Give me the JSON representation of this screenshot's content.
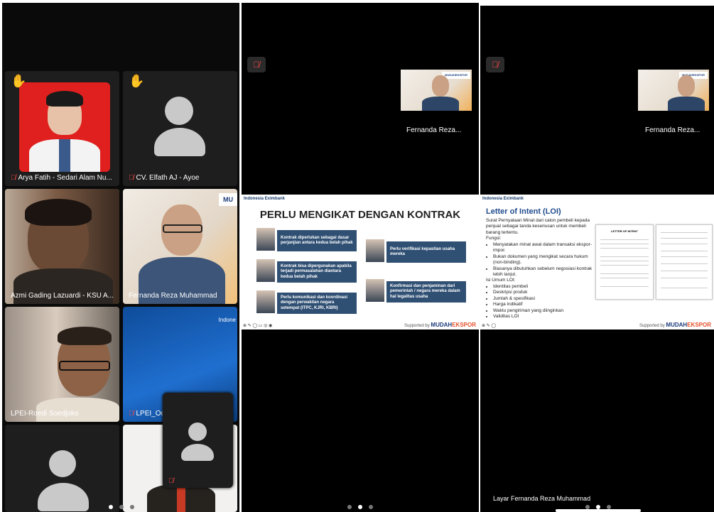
{
  "gallery": {
    "tiles": [
      {
        "name": "Arya Fatih - Sedari Alam Nu...",
        "hand": "✋"
      },
      {
        "name": "CV. Elfath AJ - Ayoe",
        "hand": "✋"
      },
      {
        "name": "Azmi Gading Lazuardi - KSU A..."
      },
      {
        "name": "Fernanda Reza Muhammad",
        "badge": "MU"
      },
      {
        "name": "LPEI-Roedi Soedjoko"
      },
      {
        "name": "LPEI_Od",
        "bg_text": "Indone"
      }
    ]
  },
  "presenter": {
    "name_1": "Fernanda Reza...",
    "name_2": "Fernanda Reza...",
    "badge_1": "MUDAHEKSPOR",
    "badge_2": "MUDAHEKSPOR"
  },
  "slide1": {
    "logo": "Indonesia Eximbank",
    "title": "PERLU MENGIKAT DENGAN KONTRAK",
    "boxes": [
      "Kontrak diperlukan sebagai dasar perjanjian antara kedua belah pihak",
      "Kontrak bisa dipergunakan apabila terjadi permasalahan diantara kedua belah pihak",
      "Perlu komunikasi dan koordinasi dengan perwakilan negara setempat (ITPC, KJRI, KBRI)",
      "Perlu verifikasi kepastian usaha mereka",
      "Konfirmasi dan penjaminan dari pemerintah / negara mereka dalam hal legalitas usaha"
    ],
    "supported": "Supported by",
    "brand_a": "MUDAH",
    "brand_b": "EKSPOR"
  },
  "slide2": {
    "logo": "Indonesia Eximbank",
    "title": "Letter of Intent (LOI)",
    "intro": "Surat Pernyataan Minat dari calon pembeli kepada penjual sebagai tanda keseriusan untuk membeli barang tertentu.",
    "fungsi_label": "Fungsi:",
    "fungsi": [
      "Menyatakan minat awal dalam transaksi ekspor-impor.",
      "Bukan dokumen yang mengikat secara hukum (non-binding).",
      "Biasanya dibutuhkan sebelum negosiasi kontrak lebih lanjut."
    ],
    "isi_label": "Isi Umum LOI:",
    "isi": [
      "Identitas pembeli",
      "Deskripsi produk",
      "Jumlah & spesifikasi",
      "Harga indikatif",
      "Waktu pengiriman yang diinginkan",
      "Validitas LOI"
    ],
    "doc_title": "LETTER OF INTENT",
    "supported": "Supported by",
    "brand_a": "MUDAH",
    "brand_b": "EKSPOR"
  },
  "screen_label": "Layar Fernanda Reza Muhammad",
  "colors": {
    "active_border": "#2fcf4d",
    "mute": "#ff4747",
    "slide_box": "#2f4f73",
    "loi_title": "#1f4b8e"
  }
}
